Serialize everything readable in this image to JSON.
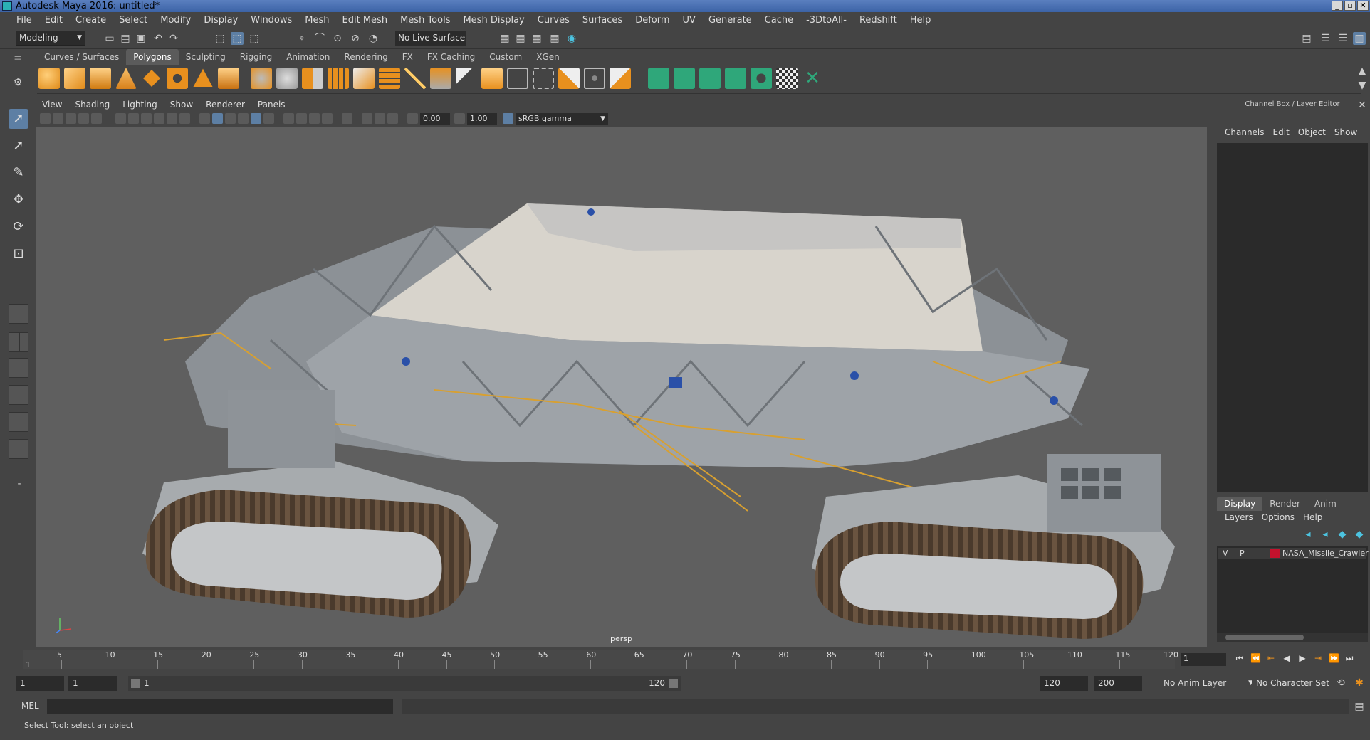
{
  "window": {
    "title": "Autodesk Maya 2016: untitled*",
    "buttons": [
      "_",
      "▫",
      "✕"
    ]
  },
  "menus": [
    "File",
    "Edit",
    "Create",
    "Select",
    "Modify",
    "Display",
    "Windows",
    "Mesh",
    "Edit Mesh",
    "Mesh Tools",
    "Mesh Display",
    "Curves",
    "Surfaces",
    "Deform",
    "UV",
    "Generate",
    "Cache",
    "-3DtoAll-",
    "Redshift",
    "Help"
  ],
  "status": {
    "mode": "Modeling",
    "live_surface": "No Live Surface"
  },
  "shelf_tabs": [
    "Curves / Surfaces",
    "Polygons",
    "Sculpting",
    "Rigging",
    "Animation",
    "Rendering",
    "FX",
    "FX Caching",
    "Custom",
    "XGen"
  ],
  "shelf_active": "Polygons",
  "panel": {
    "menus": [
      "View",
      "Shading",
      "Lighting",
      "Show",
      "Renderer",
      "Panels"
    ],
    "exposure": "0.00",
    "gamma": "1.00",
    "color_space": "sRGB gamma",
    "camera": "persp"
  },
  "channel_box": {
    "title": "Channel Box / Layer Editor",
    "menus": [
      "Channels",
      "Edit",
      "Object",
      "Show"
    ]
  },
  "layer_editor": {
    "tabs": [
      "Display",
      "Render",
      "Anim"
    ],
    "active_tab": "Display",
    "menus": [
      "Layers",
      "Options",
      "Help"
    ],
    "layer": {
      "v": "V",
      "p": "P",
      "name": "NASA_Missile_Crawler",
      "color": "#c4122d"
    }
  },
  "timeline": {
    "ticks": [
      "1",
      "5",
      "10",
      "15",
      "20",
      "25",
      "30",
      "35",
      "40",
      "45",
      "50",
      "55",
      "60",
      "65",
      "70",
      "75",
      "80",
      "85",
      "90",
      "95",
      "100",
      "105",
      "110",
      "115",
      "120"
    ],
    "current_frame": "1"
  },
  "range": {
    "start": "1",
    "playback_start": "1",
    "slider_start": "1",
    "slider_end": "120",
    "playback_end": "120",
    "end": "200",
    "anim_layer": "No Anim Layer",
    "character_set": "No Character Set"
  },
  "command": {
    "label": "MEL"
  },
  "help_line": "Select Tool: select an object",
  "colors": {
    "accent": "#5d7fa4",
    "viewport": "#5f5f5f",
    "title_bar": "#3c63a6"
  }
}
